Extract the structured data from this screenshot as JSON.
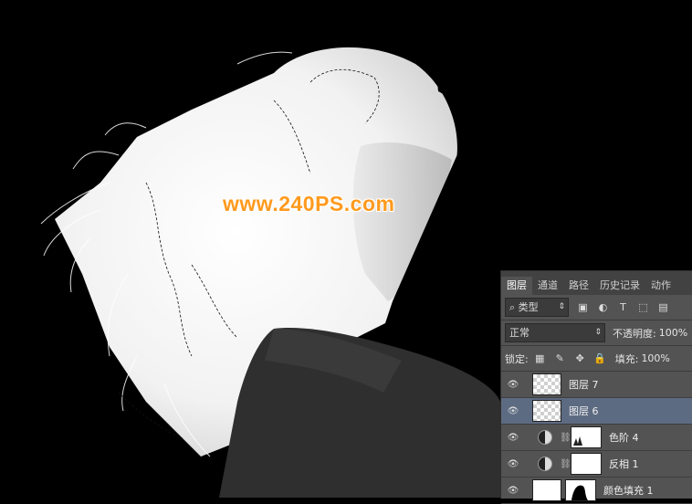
{
  "watermark": "www.240PS.com",
  "panel": {
    "tabs": [
      "图层",
      "通道",
      "路径",
      "历史记录",
      "动作"
    ],
    "active_tab": 0,
    "filter": {
      "value": "类型"
    },
    "blend_mode": {
      "value": "正常"
    },
    "opacity": {
      "label": "不透明度:",
      "value": "100%"
    },
    "lock": {
      "label": "锁定:"
    },
    "fill": {
      "label": "填充:",
      "value": "100%"
    },
    "layers": [
      {
        "name": "图层 7",
        "type": "pixel",
        "selected": false
      },
      {
        "name": "图层 6",
        "type": "pixel",
        "selected": true
      },
      {
        "name": "色阶 4",
        "type": "adjustment",
        "selected": false
      },
      {
        "name": "反相 1",
        "type": "adjustment",
        "selected": false
      },
      {
        "name": "颜色填充 1",
        "type": "fill",
        "selected": false
      }
    ]
  },
  "colors": {
    "panel_bg": "#535353",
    "selected": "#5d6b82",
    "watermark": "#ff9a1e"
  }
}
